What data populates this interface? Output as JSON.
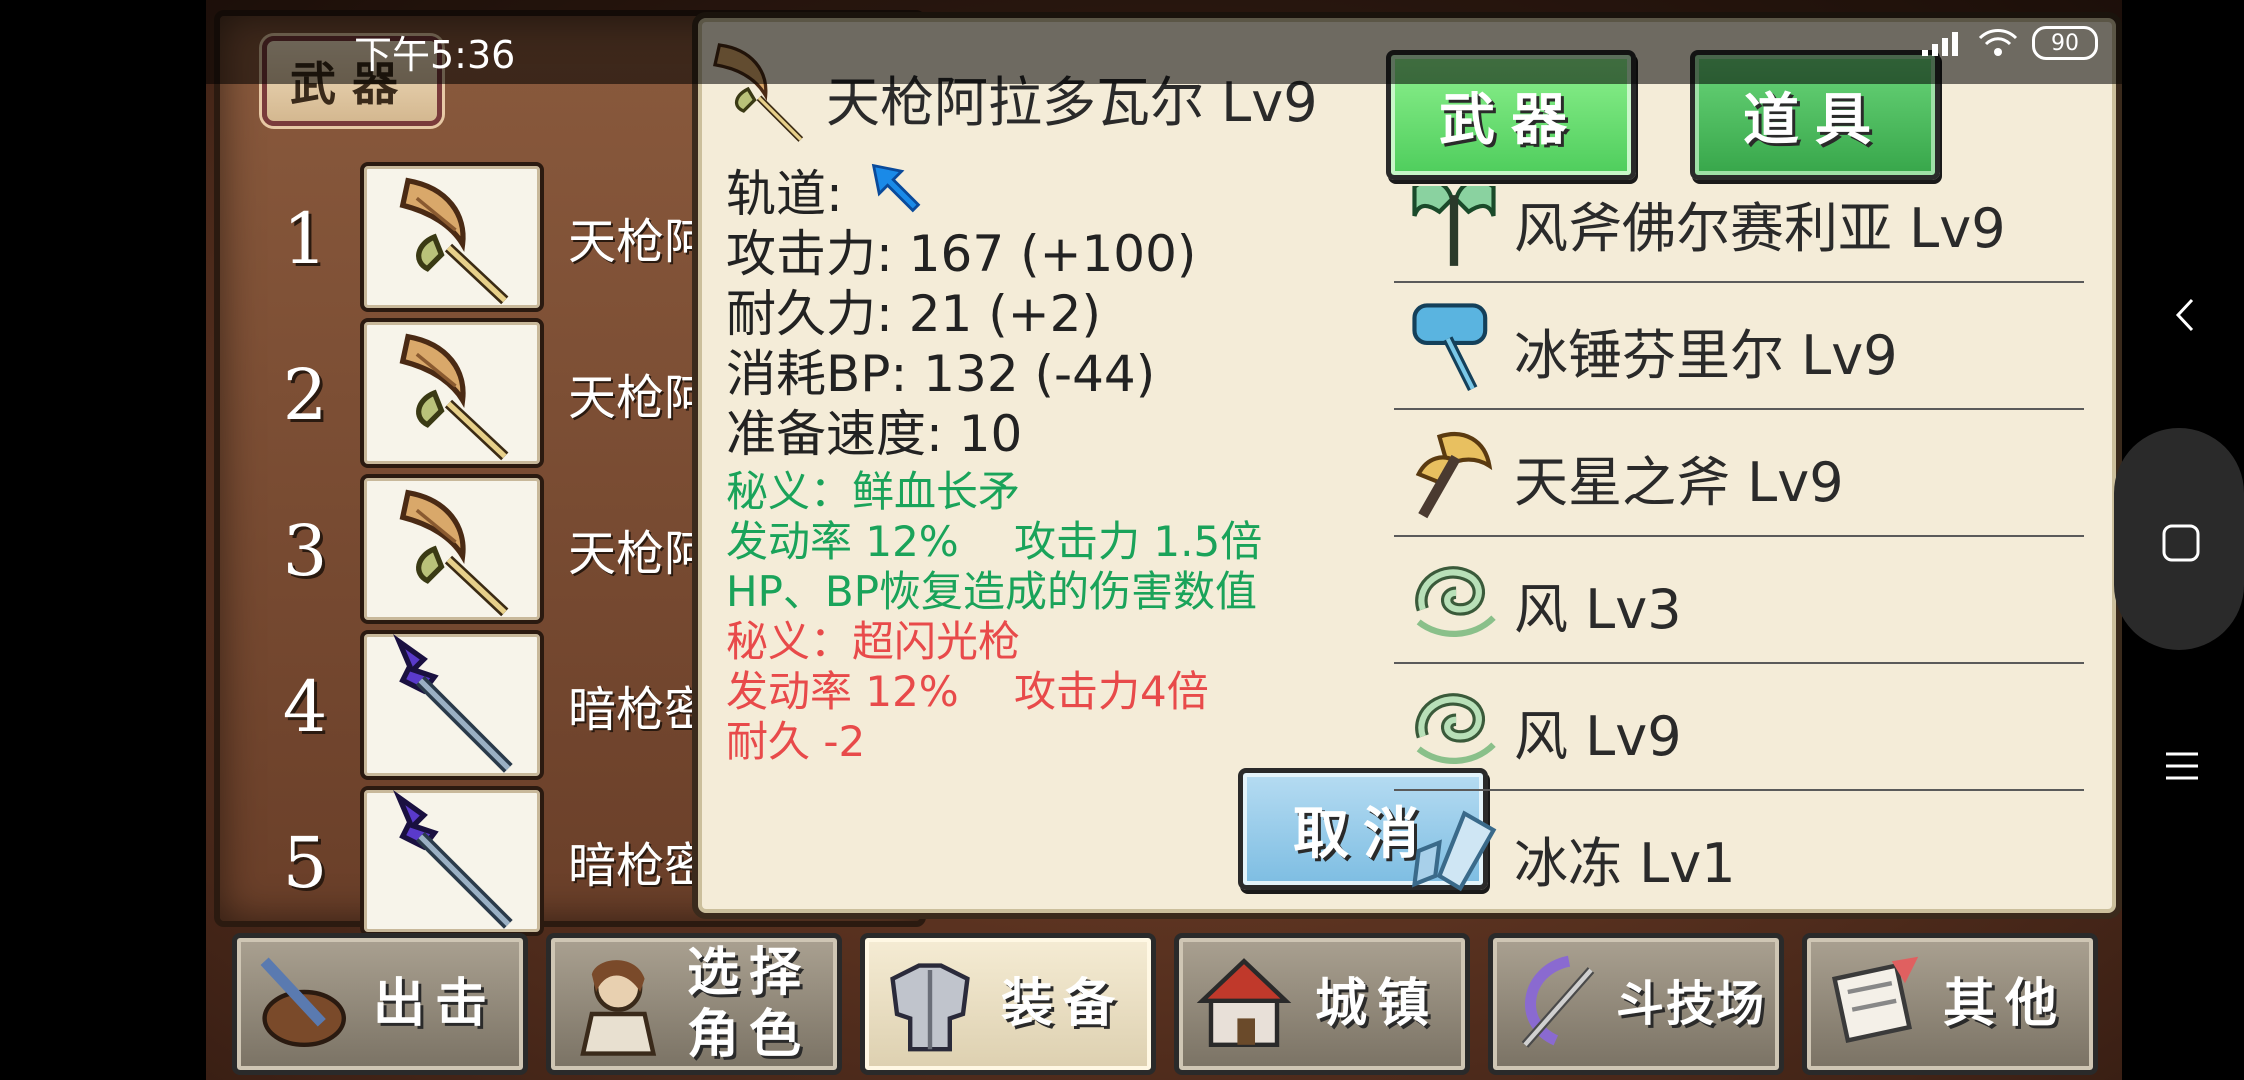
{
  "status": {
    "time": "下午5:36",
    "battery": "90"
  },
  "slot_panel": {
    "title": "武器",
    "slots": [
      {
        "num": "1",
        "name": "天枪阿",
        "icon": "golden-spear-icon"
      },
      {
        "num": "2",
        "name": "天枪阿",
        "icon": "golden-spear-icon"
      },
      {
        "num": "3",
        "name": "天枪阿",
        "icon": "golden-spear-icon"
      },
      {
        "num": "4",
        "name": "暗枪密",
        "icon": "dark-spear-icon"
      },
      {
        "num": "5",
        "name": "暗枪密",
        "icon": "dark-spear-icon"
      }
    ]
  },
  "detail": {
    "title": "天枪阿拉多瓦尔 Lv9",
    "orbit_label": "轨道:",
    "stats": {
      "attack": "攻击力: 167 (+100)",
      "durability": "耐久力: 21 (+2)",
      "bp_cost": "消耗BP: 132 (-44)",
      "prep_speed": "准备速度: 10"
    },
    "skill1": {
      "name": "秘义：鲜血长矛",
      "rate": "发动率 12%　 攻击力 1.5倍",
      "effect": "HP、BP恢复造成的伤害数值"
    },
    "skill2": {
      "name": "秘义：超闪光枪",
      "rate": "发动率 12%　 攻击力4倍",
      "effect": "耐久 -2"
    },
    "cancel": "取消"
  },
  "tabs": {
    "weapon": "武器",
    "item": "道具"
  },
  "inventory": [
    {
      "name": "风斧佛尔赛利亚 Lv9",
      "icon": "wind-axe-icon"
    },
    {
      "name": "冰锤芬里尔 Lv9",
      "icon": "ice-hammer-icon"
    },
    {
      "name": "天星之斧 Lv9",
      "icon": "star-axe-icon"
    },
    {
      "name": "风 Lv3",
      "icon": "wind-icon"
    },
    {
      "name": "风 Lv9",
      "icon": "wind-icon"
    },
    {
      "name": "冰冻 Lv1",
      "icon": "ice-crystal-icon"
    }
  ],
  "menu": [
    {
      "label": "出击",
      "icon": "sortie-icon"
    },
    {
      "label": "选择角色",
      "icon": "character-icon"
    },
    {
      "label": "装备",
      "icon": "armor-icon",
      "active": true
    },
    {
      "label": "城镇",
      "icon": "town-icon"
    },
    {
      "label": "斗技场",
      "icon": "arena-icon"
    },
    {
      "label": "其他",
      "icon": "scroll-icon"
    }
  ],
  "colors": {
    "skill_green": "#1aa35a",
    "skill_red": "#e84a4a",
    "panel_bg": "#f4ecd8"
  }
}
